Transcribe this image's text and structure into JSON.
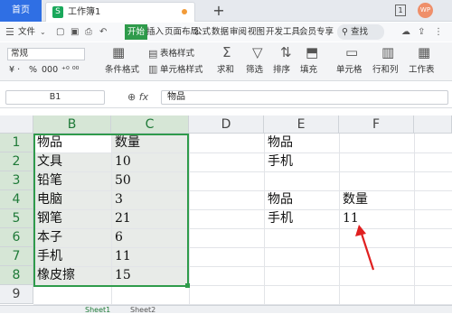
{
  "tabs": {
    "home": "首页",
    "doc_icon": "S",
    "doc_title": "工作簿1",
    "new_tab": "+",
    "window_count": "1",
    "avatar": "WP"
  },
  "menu": {
    "file": "文件",
    "items": [
      "开始",
      "插入",
      "页面布局",
      "公式",
      "数据",
      "审阅",
      "视图",
      "开发工具",
      "会员专享"
    ],
    "search": "查找"
  },
  "ribbon": {
    "number_format": "常规",
    "cond_format": "条件格式",
    "table_style": "表格样式",
    "cell_style": "单元格样式",
    "sum": "求和",
    "filter": "筛选",
    "sort": "排序",
    "fill": "填充",
    "cell": "单元格",
    "row_col": "行和列",
    "worksheet": "工作表",
    "percent": "%",
    "thousands": "000"
  },
  "formula_bar": {
    "cell_ref": "B1",
    "fx": "fx",
    "value": "物品"
  },
  "columns": [
    "B",
    "C",
    "D",
    "E",
    "F"
  ],
  "rows": [
    "1",
    "2",
    "3",
    "4",
    "5",
    "6",
    "7",
    "8",
    "9"
  ],
  "table_b_c": [
    [
      "物品",
      "数量"
    ],
    [
      "文具",
      "10"
    ],
    [
      "铅笔",
      "50"
    ],
    [
      "电脑",
      "3"
    ],
    [
      "钢笔",
      "21"
    ],
    [
      "本子",
      "6"
    ],
    [
      "手机",
      "11"
    ],
    [
      "橡皮擦",
      "15"
    ]
  ],
  "lookup": {
    "e1": "物品",
    "e2": "手机",
    "e4": "物品",
    "f4": "数量",
    "e5": "手机",
    "f5": "11"
  },
  "sheets": [
    "Sheet1",
    "Sheet2"
  ],
  "colors": {
    "accent_green": "#2f9b4b",
    "tab_blue": "#2f6fe4",
    "arrow_red": "#e02020"
  }
}
